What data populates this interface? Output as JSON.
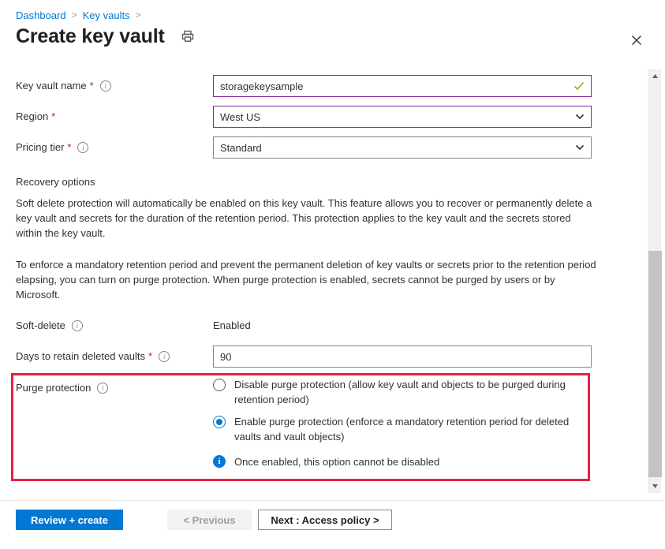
{
  "breadcrumb": {
    "items": [
      {
        "label": "Dashboard"
      },
      {
        "label": "Key vaults"
      }
    ],
    "separator": ">"
  },
  "header": {
    "title": "Create key vault",
    "print_icon": "printer-icon",
    "close_icon": "close-icon",
    "close_glyph": "✕"
  },
  "colors": {
    "accent_blue": "#0078d4",
    "link_blue": "#0078d4",
    "required_red": "#a4262c",
    "highlight_red": "#e8203f",
    "input_accent_purple": "#8c29a0",
    "check_green": "#7fba00",
    "border_gray": "#8a8886",
    "scroll_thumb": "#c3c3c3"
  },
  "fields": {
    "key_vault_name": {
      "label": "Key vault name",
      "required_marker": "*",
      "info_icon": "info-icon",
      "value": "storagekeysample",
      "placeholder": "",
      "validation_icon": "checkmark-icon",
      "border_state": "accent"
    },
    "region": {
      "label": "Region",
      "required_marker": "*",
      "value": "West US",
      "dropdown_icon": "chevron-down-icon",
      "border_state": "accent"
    },
    "pricing_tier": {
      "label": "Pricing tier",
      "required_marker": "*",
      "info_icon": "info-icon",
      "value": "Standard",
      "dropdown_icon": "chevron-down-icon",
      "border_state": "normal"
    },
    "soft_delete": {
      "label": "Soft-delete",
      "info_icon": "info-icon",
      "value": "Enabled"
    },
    "days_to_retain": {
      "label": "Days to retain deleted vaults",
      "required_marker": "*",
      "info_icon": "info-icon",
      "value": "90",
      "placeholder": ""
    },
    "purge_protection": {
      "label": "Purge protection",
      "info_icon": "info-icon",
      "options": [
        {
          "label": "Disable purge protection (allow key vault and objects to be purged during retention period)",
          "selected": false
        },
        {
          "label": "Enable purge protection (enforce a mandatory retention period for deleted vaults and vault objects)",
          "selected": true
        }
      ],
      "note": {
        "icon": "info-filled-icon",
        "icon_glyph": "i",
        "text": "Once enabled, this option cannot be disabled"
      }
    }
  },
  "recovery_options": {
    "heading": "Recovery options",
    "paragraph_1": "Soft delete protection will automatically be enabled on this key vault. This feature allows you to recover or permanently delete a key vault and secrets for the duration of the retention period. This protection applies to the key vault and the secrets stored within the key vault.",
    "paragraph_2": "To enforce a mandatory retention period and prevent the permanent deletion of key vaults or secrets prior to the retention period elapsing, you can turn on purge protection. When purge protection is enabled, secrets cannot be purged by users or by Microsoft."
  },
  "scrollbar": {
    "up_arrow_icon": "triangle-up-icon",
    "down_arrow_icon": "triangle-down-icon"
  },
  "footer": {
    "review_create_label": "Review + create",
    "previous_label": "< Previous",
    "next_label": "Next : Access policy >"
  }
}
